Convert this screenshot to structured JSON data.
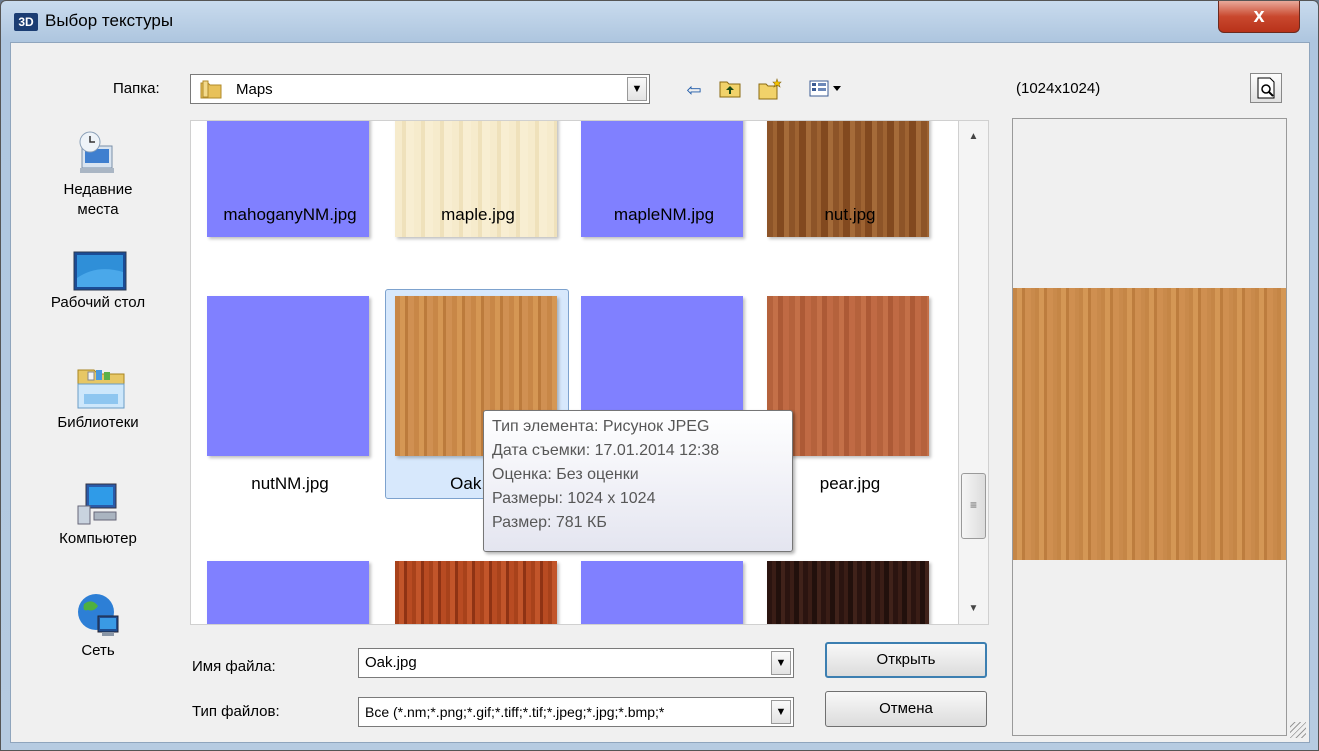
{
  "window": {
    "app_badge": "3D",
    "title": "Выбор текстуры",
    "close_label": "x"
  },
  "toolbar": {
    "folder_label": "Папка:",
    "folder_value": "Maps"
  },
  "places": [
    {
      "label": "Недавние места"
    },
    {
      "label": "Рабочий стол"
    },
    {
      "label": "Библиотеки"
    },
    {
      "label": "Компьютер"
    },
    {
      "label": "Сеть"
    }
  ],
  "files": [
    {
      "name": "mahoganyNM.jpg",
      "texture": "normal-map"
    },
    {
      "name": "maple.jpg",
      "texture": "maple"
    },
    {
      "name": "mapleNM.jpg",
      "texture": "normal-map"
    },
    {
      "name": "nut.jpg",
      "texture": "nut"
    },
    {
      "name": "nutNM.jpg",
      "texture": "normal-map"
    },
    {
      "name": "Oak.jpg",
      "texture": "oak",
      "selected": true
    },
    {
      "name": "",
      "texture": "normal-map"
    },
    {
      "name": "pear.jpg",
      "texture": "pear"
    },
    {
      "name": "",
      "texture": "normal-map"
    },
    {
      "name": "",
      "texture": "cherry"
    },
    {
      "name": "",
      "texture": "normal-map"
    },
    {
      "name": "",
      "texture": "wenge"
    }
  ],
  "selected_label": "Oak.j",
  "tooltip": {
    "type": "Тип элемента: Рисунок JPEG",
    "date": "Дата съемки: 17.01.2014 12:38",
    "rating": "Оценка: Без оценки",
    "dimensions": "Размеры: 1024 x 1024",
    "size": "Размер: 781 КБ"
  },
  "preview": {
    "resolution": "(1024x1024)"
  },
  "form": {
    "filename_label": "Имя файла:",
    "filename_value": "Oak.jpg",
    "filetype_label": "Тип файлов:",
    "filetype_value": "Все (*.nm;*.png;*.gif;*.tiff;*.tif;*.jpeg;*.jpg;*.bmp;*",
    "open_label": "Открыть",
    "cancel_label": "Отмена"
  },
  "colors": {
    "normal_map": "#8080ff",
    "selection": "#d7e8fc",
    "title_gradient": "#aec6df"
  }
}
